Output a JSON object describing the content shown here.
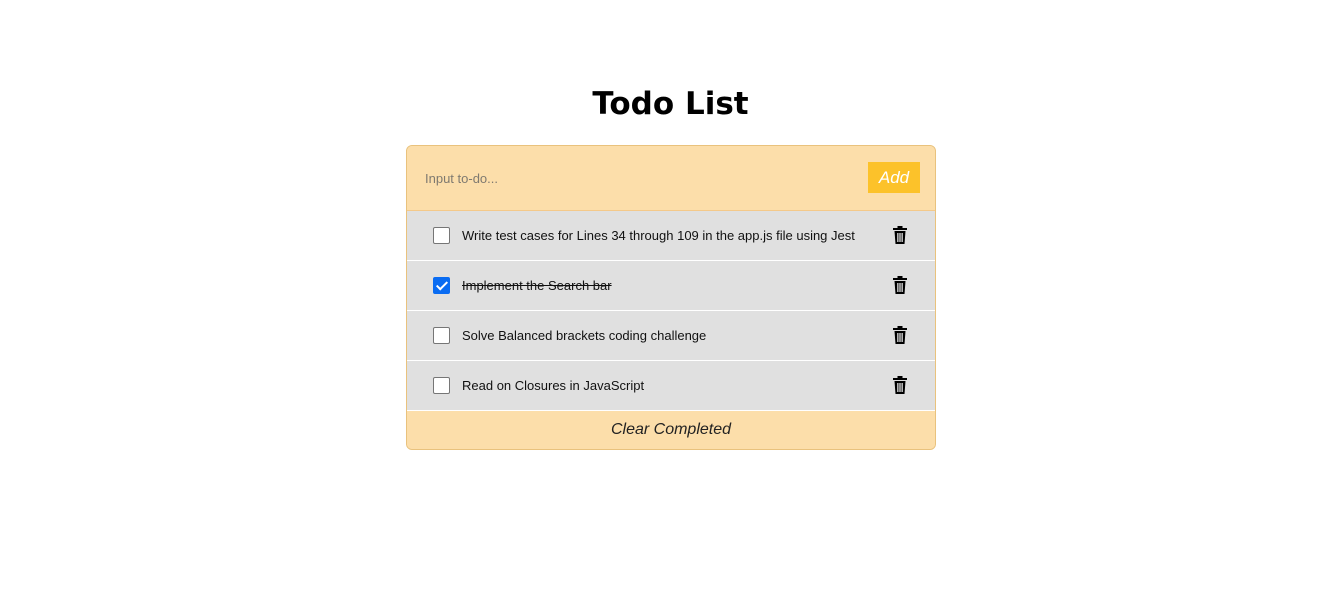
{
  "header": {
    "title": "Todo List"
  },
  "input": {
    "placeholder": "Input to-do...",
    "value": "",
    "add_label": "Add"
  },
  "todos": [
    {
      "text": "Write test cases for Lines 34 through 109 in the app.js file using Jest",
      "completed": false,
      "delete_icon": "trash-icon"
    },
    {
      "text": "Implement the Search bar",
      "completed": true,
      "delete_icon": "trash-icon"
    },
    {
      "text": "Solve Balanced brackets coding challenge",
      "completed": false,
      "delete_icon": "trash-icon"
    },
    {
      "text": "Read on Closures in JavaScript",
      "completed": false,
      "delete_icon": "trash-icon"
    }
  ],
  "footer": {
    "clear_label": "Clear Completed"
  },
  "colors": {
    "panel": "#fcdeaa",
    "add_button": "#fcc22a",
    "item_background": "#e0e0e0",
    "checkbox_checked": "#0a6cf2"
  }
}
